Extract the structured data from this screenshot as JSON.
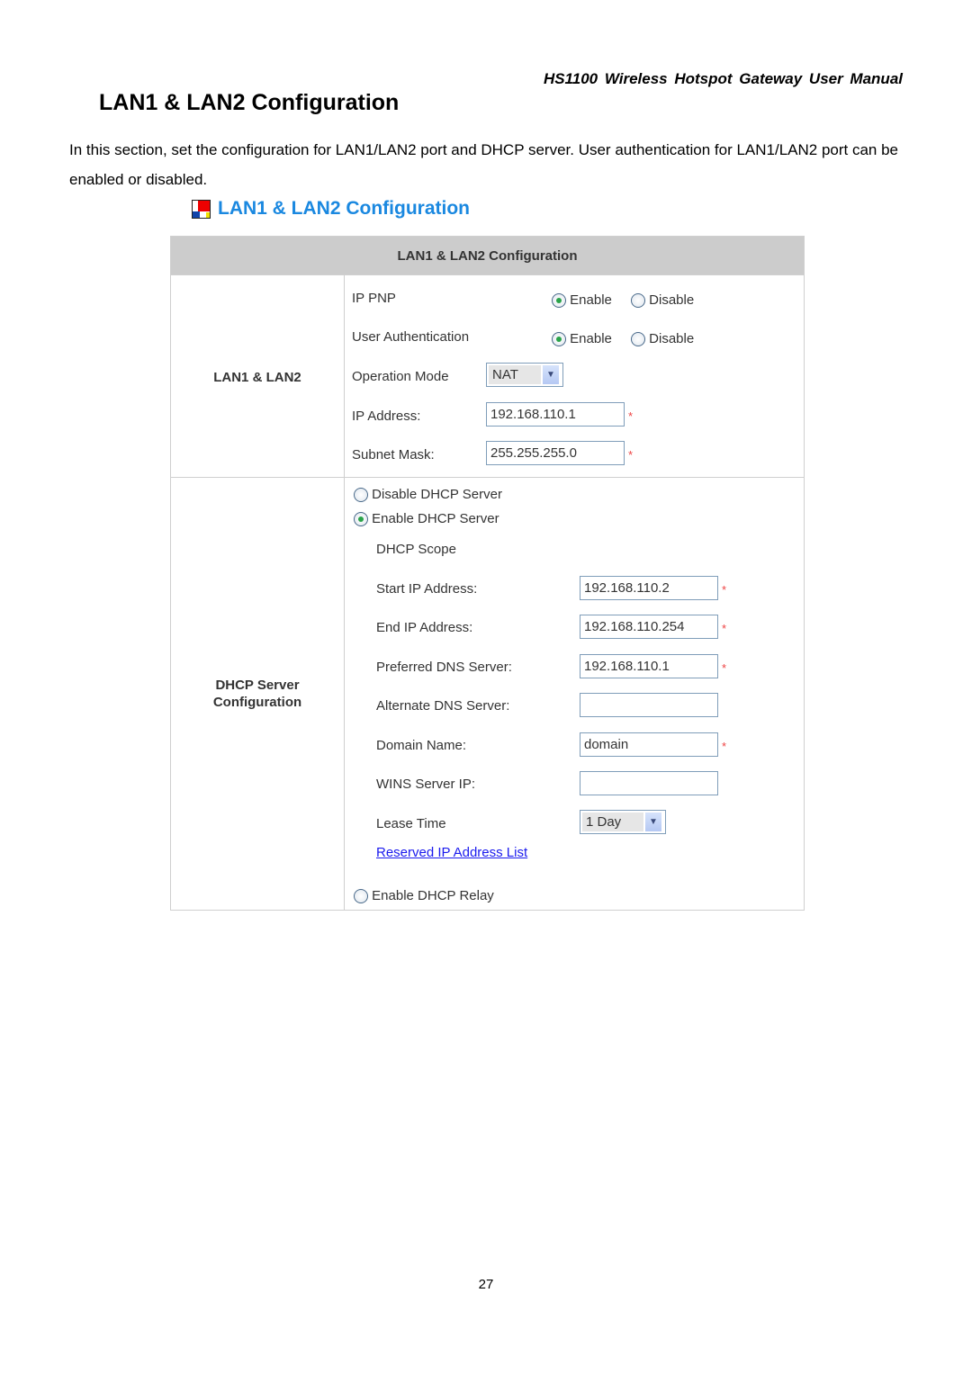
{
  "header": {
    "manual_title": "HS1100  Wireless  Hotspot  Gateway  User  Manual"
  },
  "section": {
    "title": "LAN1 & LAN2 Configuration",
    "intro": "In this section, set the configuration for LAN1/LAN2 port and DHCP server. User authentication for LAN1/LAN2 port can be enabled or disabled."
  },
  "figure": {
    "title": "LAN1 & LAN2 Configuration",
    "icon": "config-logo-icon",
    "table_header": "LAN1 & LAN2 Configuration",
    "lan": {
      "label": "LAN1 & LAN2",
      "ip_pnp": {
        "label": "IP PNP",
        "enable": "Enable",
        "disable": "Disable",
        "selected": "Enable"
      },
      "user_auth": {
        "label": "User Authentication",
        "enable": "Enable",
        "disable": "Disable",
        "selected": "Enable"
      },
      "operation_mode": {
        "label": "Operation Mode",
        "value": "NAT"
      },
      "ip_address": {
        "label": "IP Address:",
        "value": "192.168.110.1"
      },
      "subnet_mask": {
        "label": "Subnet Mask:",
        "value": "255.255.255.0"
      },
      "required_mark": "*"
    },
    "dhcp": {
      "label_line1": "DHCP Server",
      "label_line2": "Configuration",
      "disable_server": "Disable DHCP Server",
      "enable_server": "Enable DHCP Server",
      "enable_relay": "Enable DHCP Relay",
      "selected": "Enable DHCP Server",
      "scope_label": "DHCP Scope",
      "start_ip": {
        "label": "Start IP Address:",
        "value": "192.168.110.2"
      },
      "end_ip": {
        "label": "End IP Address:",
        "value": "192.168.110.254"
      },
      "preferred_dns": {
        "label": "Preferred DNS Server:",
        "value": "192.168.110.1"
      },
      "alternate_dns": {
        "label": "Alternate DNS Server:",
        "value": ""
      },
      "domain_name": {
        "label": "Domain Name:",
        "value": "domain"
      },
      "wins_ip": {
        "label": "WINS Server IP:",
        "value": ""
      },
      "lease_time": {
        "label": "Lease Time",
        "value": "1 Day"
      },
      "reserved_link": "Reserved IP Address List"
    }
  },
  "footer": {
    "page_number": "27"
  }
}
